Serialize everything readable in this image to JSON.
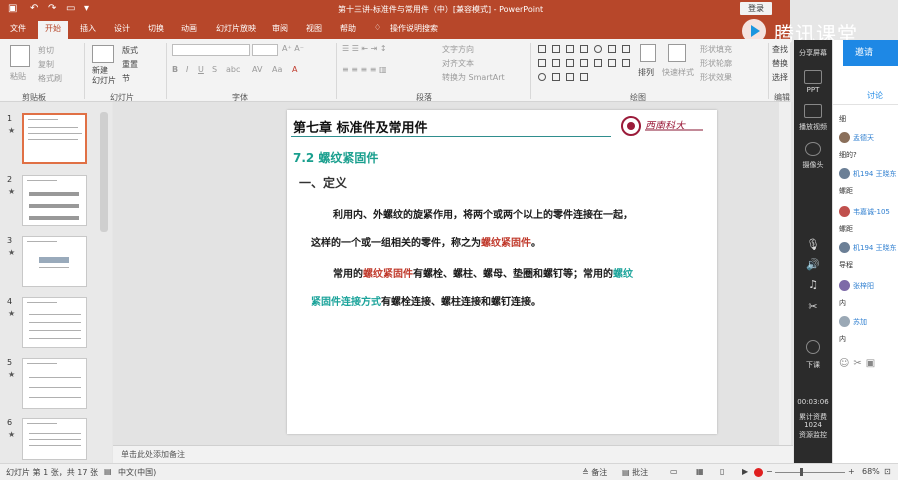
{
  "titlebar": {
    "title": "第十三讲-标准件与常用件（中）[兼容模式] - PowerPoint",
    "login": "登录"
  },
  "tabs": [
    "文件",
    "开始",
    "插入",
    "设计",
    "切换",
    "动画",
    "幻灯片放映",
    "审阅",
    "视图",
    "帮助",
    "操作说明搜索"
  ],
  "ribbon": {
    "paste": "粘贴",
    "cut": "剪切",
    "copy": "复制",
    "format_painter": "格式刷",
    "new_slide": "新建\n幻灯片",
    "layout": "版式",
    "reset": "重置",
    "section": "节",
    "text_direction": "文字方向",
    "align_text": "对齐文本",
    "smartart": "转换为 SmartArt",
    "arrange": "排列",
    "quick_styles": "快速样式",
    "shape_fill": "形状填充",
    "shape_outline": "形状轮廓",
    "shape_effects": "形状效果",
    "find": "查找",
    "replace": "替换",
    "select": "选择",
    "groups": {
      "clipboard": "剪贴板",
      "slides": "幻灯片",
      "font": "字体",
      "paragraph": "段落",
      "drawing": "绘图",
      "editing": "编辑"
    }
  },
  "tencent": {
    "name": "腾讯课堂",
    "share": "分享屏幕",
    "invite": "邀请"
  },
  "thumbnails": [
    {
      "num": "1",
      "star": "★"
    },
    {
      "num": "2",
      "star": "★"
    },
    {
      "num": "3",
      "star": "★"
    },
    {
      "num": "4",
      "star": "★"
    },
    {
      "num": "5",
      "star": "★"
    },
    {
      "num": "6",
      "star": "★"
    }
  ],
  "slide": {
    "header_title": "第七章    标准件及常用件",
    "logo_text": "西南科大",
    "section": "7.2 螺纹紧固件",
    "subsection": "一、定义",
    "para1_a": "利用内、外螺纹的旋紧作用，将两个或两个以上的零件连接在一起，",
    "para1_b": "这样的一个或一组相关的零件，称之为",
    "para1_b_red": "螺纹紧固件",
    "para1_b_end": "。",
    "para2_a": "常用的",
    "para2_a_red": "螺纹紧固件",
    "para2_a_mid": "有螺栓、螺柱、螺母、垫圈和螺钉等；常用的",
    "para2_a_teal": "螺纹",
    "para2_b_teal": "紧固件连接方式",
    "para2_b_end": "有螺栓连接、螺柱连接和螺钉连接。"
  },
  "notes": {
    "placeholder": "单击此处添加备注"
  },
  "status": {
    "slide_info": "幻灯片 第 1 张，共 17 张",
    "language": "中文(中国)",
    "notes": "备注",
    "comments": "批注",
    "zoom": "68%"
  },
  "darkbar": {
    "share_label": "分享屏幕",
    "ppt": "PPT",
    "play_video": "播放视频",
    "camera": "摄像头",
    "end_class": "下课",
    "timer": "00:03:06",
    "total_label": "累计资费",
    "total_value": "1024",
    "resource": "资源监控"
  },
  "chat": {
    "tab": "讨论",
    "messages": [
      {
        "name": "",
        "text": "细"
      },
      {
        "name": "孟德天",
        "text": "细的?"
      },
      {
        "name": "机194 王晓东",
        "text": "螺距"
      },
      {
        "name": "韦嘉诚-105",
        "text": "螺距"
      },
      {
        "name": "机194 王晓东",
        "text": "导程"
      },
      {
        "name": "张梓阳",
        "text": "内"
      },
      {
        "name": "苏加",
        "text": "内"
      }
    ]
  },
  "colors": {
    "ppt_accent": "#b7472a",
    "title_teal": "#1a9f8e",
    "keyword_red": "#c0392b",
    "keyword_teal": "#1aa39a",
    "tencent_blue": "#1e88e5"
  }
}
